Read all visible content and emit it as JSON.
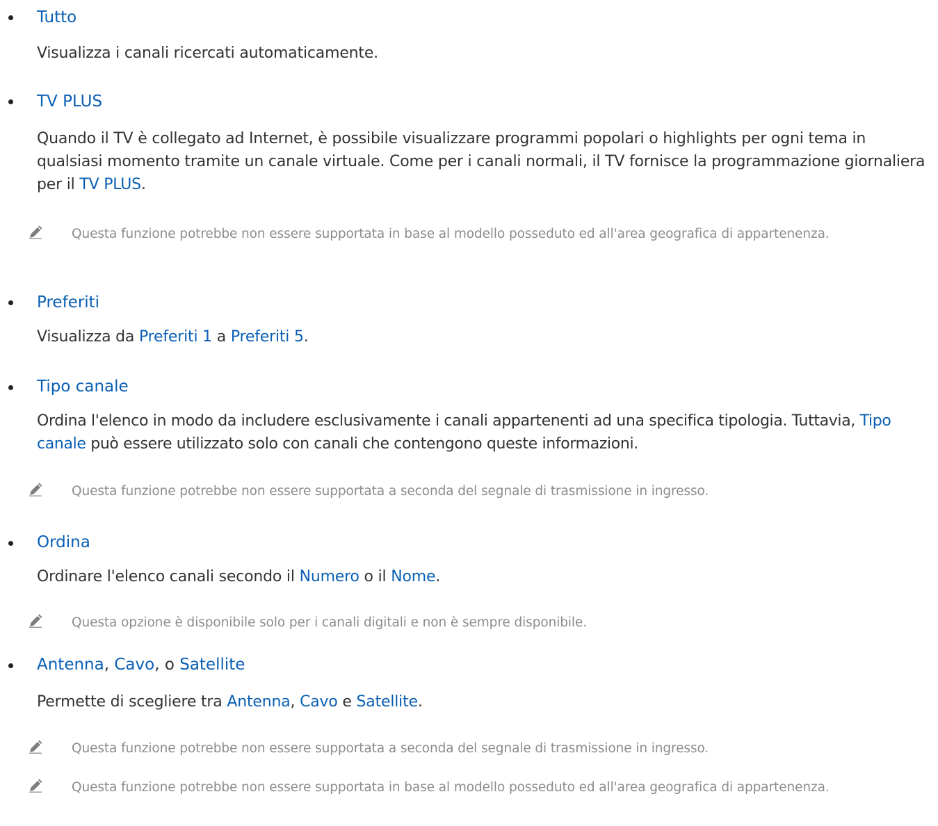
{
  "items": [
    {
      "head": "Tutto",
      "desc": "Visualizza i canali ricercati automaticamente."
    },
    {
      "head": "TV PLUS",
      "desc_pre": "Quando il TV è collegato ad Internet, è possibile visualizzare programmi popolari o highlights per ogni tema in qualsiasi momento tramite un canale virtuale. Come per i canali normali, il TV fornisce la programmazione giornaliera per il ",
      "desc_kw": "TV PLUS",
      "desc_post": ".",
      "note": "Questa funzione potrebbe non essere supportata in base al modello posseduto ed all'area geografica di appartenenza."
    },
    {
      "head": "Preferiti",
      "desc_pre": "Visualizza da ",
      "desc_kw1": "Preferiti 1",
      "desc_mid": " a ",
      "desc_kw2": "Preferiti 5",
      "desc_post": "."
    },
    {
      "head": "Tipo canale",
      "desc_pre": "Ordina l'elenco in modo da includere esclusivamente i canali appartenenti ad una specifica tipologia. Tuttavia, ",
      "desc_kw": "Tipo canale",
      "desc_post": " può essere utilizzato solo con canali che contengono queste informazioni.",
      "note": "Questa funzione potrebbe non essere supportata a seconda del segnale di trasmissione in ingresso."
    },
    {
      "head": "Ordina",
      "desc_pre": "Ordinare l'elenco canali secondo il ",
      "desc_kw1": "Numero",
      "desc_mid": " o il ",
      "desc_kw2": "Nome",
      "desc_post": ".",
      "note": "Questa opzione è disponibile solo per i canali digitali e non è sempre disponibile."
    },
    {
      "head_kw1": "Antenna",
      "head_sep1": ", ",
      "head_kw2": "Cavo",
      "head_sep2": ", o ",
      "head_kw3": "Satellite",
      "desc_pre": "Permette di scegliere tra ",
      "desc_kw1": "Antenna",
      "desc_sep1": ", ",
      "desc_kw2": "Cavo",
      "desc_sep2": " e ",
      "desc_kw3": "Satellite",
      "desc_post": ".",
      "note1": "Questa funzione potrebbe non essere supportata a seconda del segnale di trasmissione in ingresso.",
      "note2": "Questa funzione potrebbe non essere supportata in base al modello posseduto ed all'area geografica di appartenenza."
    }
  ],
  "icons": {
    "note": "pencil-icon"
  },
  "colors": {
    "link": "#0a5fb4",
    "text": "#333333",
    "note": "#8c8c8c"
  }
}
